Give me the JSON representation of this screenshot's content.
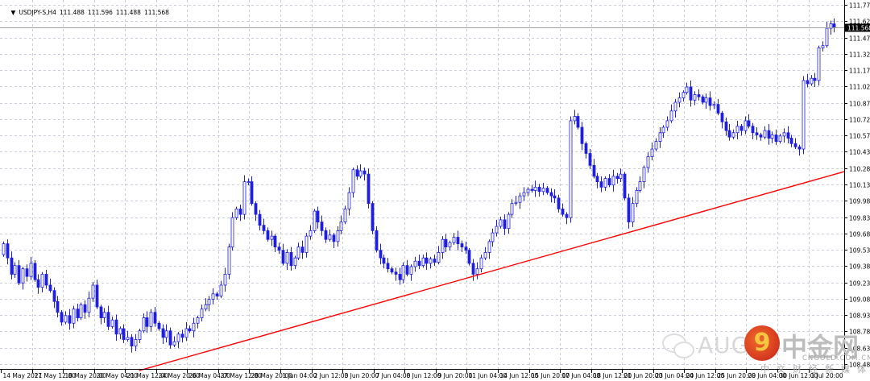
{
  "header": {
    "symbol": "USDJPY-S,H4",
    "open": "111.488",
    "high": "111.596",
    "low": "111.488",
    "close": "111.568"
  },
  "watermark": {
    "brand_latin": "AUG",
    "brand_cn": "中金网",
    "domain": "CNGOLD.COM.CN",
    "slogan": "中文财经新媒体"
  },
  "colors": {
    "candle": "#1f1fe0",
    "trendline": "#ff0000",
    "grid": "#b8bfcc",
    "price_tag_bg": "#000000"
  },
  "chart_data": {
    "type": "candlestick",
    "title": "USDJPY-S,H4",
    "timeframe": "H4",
    "current_price": 111.568,
    "current_price_label": "111.568",
    "ylim": [
      108.43,
      111.82
    ],
    "y_ticks": [
      "111.775",
      "111.625",
      "111.475",
      "111.325",
      "111.175",
      "111.025",
      "110.875",
      "110.725",
      "110.575",
      "110.430",
      "110.280",
      "110.130",
      "109.980",
      "109.830",
      "109.680",
      "109.530",
      "109.380",
      "109.230",
      "109.080",
      "108.930",
      "108.780",
      "108.630",
      "108.480"
    ],
    "x_ticks": [
      "14 May 2021",
      "17 May 12:00",
      "18 May 20:00",
      "20 May 04:00",
      "21 May 12:00",
      "24 May 20:00",
      "26 May 04:00",
      "27 May 12:00",
      "28 May 20:00",
      "1 Jun 04:00",
      "2 Jun 12:00",
      "3 Jun 20:00",
      "7 Jun 04:00",
      "8 Jun 12:00",
      "9 Jun 20:00",
      "11 Jun 04:00",
      "14 Jun 12:00",
      "15 Jun 20:00",
      "17 Jun 04:00",
      "18 Jun 12:00",
      "21 Jun 20:00",
      "23 Jun 04:00",
      "24 Jun 12:00",
      "25 Jun 20:00",
      "29 Jun 04:00",
      "30 Jun 12:00",
      "1 Jul 20:00"
    ],
    "candles_per_tick": 8,
    "closes": [
      109.58,
      109.45,
      109.3,
      109.38,
      109.22,
      109.35,
      109.28,
      109.4,
      109.25,
      109.18,
      109.3,
      109.2,
      109.15,
      109.05,
      108.95,
      108.86,
      108.92,
      108.85,
      108.98,
      108.9,
      109.02,
      108.95,
      109.08,
      109.2,
      109.0,
      108.9,
      108.95,
      108.82,
      108.88,
      108.75,
      108.8,
      108.7,
      108.72,
      108.64,
      108.7,
      108.78,
      108.9,
      108.82,
      108.95,
      108.85,
      108.8,
      108.72,
      108.78,
      108.65,
      108.68,
      108.75,
      108.72,
      108.8,
      108.78,
      108.85,
      108.9,
      108.98,
      109.02,
      109.07,
      109.12,
      109.1,
      109.2,
      109.3,
      109.55,
      109.82,
      109.9,
      109.85,
      110.15,
      110.15,
      109.95,
      109.85,
      109.75,
      109.7,
      109.62,
      109.65,
      109.55,
      109.52,
      109.4,
      109.5,
      109.38,
      109.45,
      109.55,
      109.5,
      109.65,
      109.7,
      109.88,
      109.78,
      109.7,
      109.62,
      109.66,
      109.6,
      109.7,
      109.78,
      109.9,
      110.05,
      110.26,
      110.2,
      110.25,
      110.22,
      109.95,
      109.7,
      109.52,
      109.45,
      109.4,
      109.35,
      109.32,
      109.3,
      109.25,
      109.38,
      109.3,
      109.37,
      109.42,
      109.38,
      109.45,
      109.4,
      109.44,
      109.41,
      109.5,
      109.62,
      109.55,
      109.59,
      109.64,
      109.58,
      109.55,
      109.52,
      109.4,
      109.3,
      109.35,
      109.45,
      109.5,
      109.6,
      109.68,
      109.74,
      109.8,
      109.72,
      109.85,
      109.95,
      109.96,
      110.02,
      110.05,
      110.08,
      110.07,
      110.1,
      110.06,
      110.09,
      110.05,
      110.02,
      110.0,
      109.9,
      109.85,
      109.82,
      110.71,
      110.75,
      110.65,
      110.5,
      110.41,
      110.3,
      110.2,
      110.15,
      110.1,
      110.18,
      110.12,
      110.2,
      110.18,
      110.22,
      110.0,
      109.78,
      109.95,
      110.07,
      110.15,
      110.28,
      110.38,
      110.45,
      110.52,
      110.6,
      110.65,
      110.71,
      110.8,
      110.88,
      110.92,
      110.97,
      111.02,
      110.9,
      110.95,
      110.93,
      110.88,
      110.92,
      110.85,
      110.86,
      110.78,
      110.7,
      110.62,
      110.56,
      110.6,
      110.66,
      110.62,
      110.71,
      110.66,
      110.6,
      110.58,
      110.56,
      110.62,
      110.55,
      110.58,
      110.52,
      110.57,
      110.6,
      110.55,
      110.5,
      110.47,
      110.45,
      111.08,
      111.05,
      111.1,
      111.08,
      111.38,
      111.4,
      111.56,
      111.6,
      111.568
    ],
    "trendline": {
      "from_price": 108.415,
      "from_candle": 35,
      "to_price": 110.243,
      "to_candle": 217
    },
    "grid": true
  }
}
